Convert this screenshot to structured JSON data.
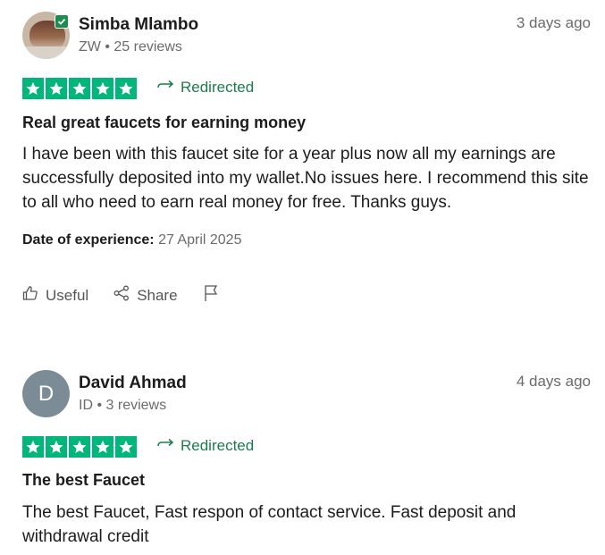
{
  "reviews": [
    {
      "name": "Simba Mlambo",
      "country": "ZW",
      "review_count": "25 reviews",
      "date_ago": "3 days ago",
      "rating": 5,
      "status": "Redirected",
      "title": "Real great faucets for earning money",
      "body": "I have been with this faucet site for a year plus now all my earnings are successfully deposited into my wallet.No issues here. I recommend this site to all who need to earn real money for free. Thanks guys.",
      "experience_label": "Date of experience:",
      "experience_date": "27 April 2025",
      "actions": {
        "useful": "Useful",
        "share": "Share"
      },
      "avatar": "photo",
      "verified": true
    },
    {
      "name": "David Ahmad",
      "country": "ID",
      "review_count": "3 reviews",
      "date_ago": "4 days ago",
      "rating": 5,
      "status": "Redirected",
      "title": "The best Faucet",
      "body": "The best Faucet, Fast respon of contact service. Fast deposit and withdrawal credit",
      "avatar_letter": "D"
    }
  ],
  "separator": "•",
  "colors": {
    "star_green": "#00b67a",
    "redirect_green": "#1d7c4d",
    "avatar_grey": "#7b8c97"
  }
}
